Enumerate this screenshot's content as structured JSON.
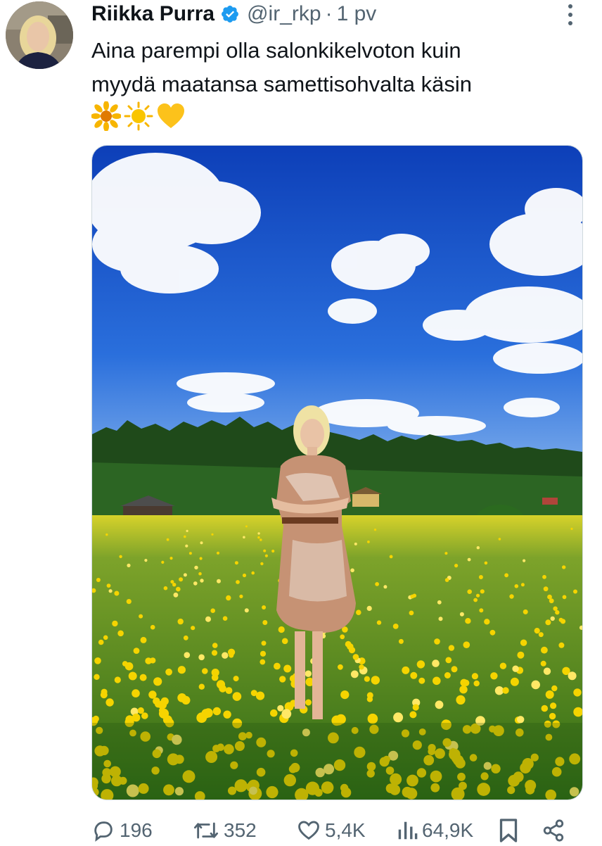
{
  "author": {
    "display_name": "Riikka Purra",
    "handle": "@ir_rkp",
    "separator": "·",
    "timestamp": "1 pv",
    "verified": true
  },
  "tweet": {
    "text": "Aina parempi olla salonkikelvoton kuin\nmyydä maatansa samettisohvalta käsin",
    "emojis": [
      "sunflower-icon",
      "sun-icon",
      "yellow-heart-icon"
    ]
  },
  "media": {
    "kind": "photo"
  },
  "actions": {
    "replies": "196",
    "reposts": "352",
    "likes": "5,4K",
    "views": "64,9K"
  },
  "colors": {
    "text": "#0f1419",
    "secondary": "#536471",
    "verified": "#1d9bf0",
    "sky": "#1a5fd0",
    "field": "#3d7a1e",
    "dandelion": "#f5d000"
  }
}
